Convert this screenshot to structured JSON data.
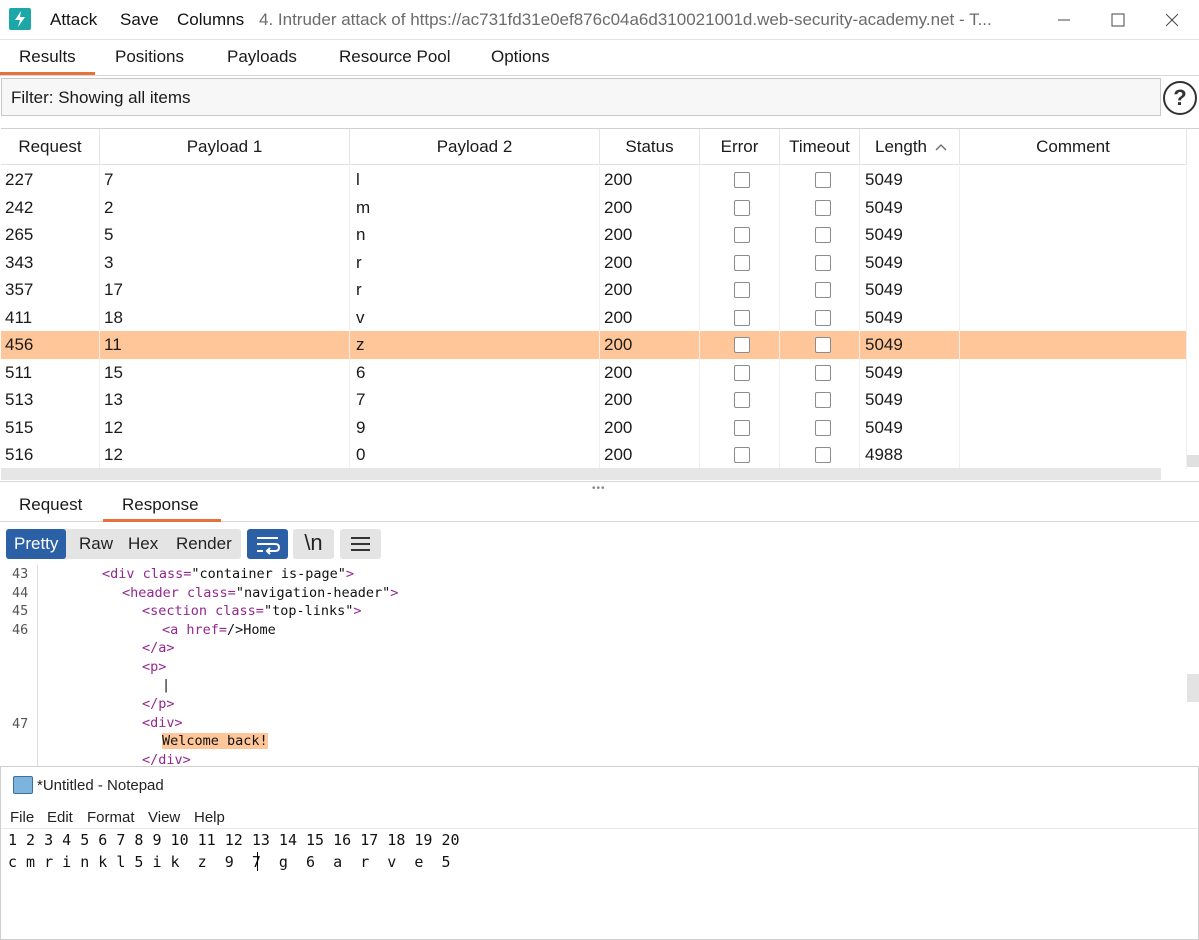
{
  "titlebar": {
    "menu": [
      "Attack",
      "Save",
      "Columns"
    ],
    "title": "4. Intruder attack of https://ac731fd31e0ef876c04a6d310021001d.web-security-academy.net - T..."
  },
  "tabs": [
    "Results",
    "Positions",
    "Payloads",
    "Resource Pool",
    "Options"
  ],
  "active_tab": "Results",
  "filter": {
    "text": "Filter: Showing all items",
    "help": "?"
  },
  "table": {
    "columns": [
      "Request",
      "Payload 1",
      "Payload 2",
      "Status",
      "Error",
      "Timeout",
      "Length",
      "Comment"
    ],
    "sort_column": "Length",
    "rows": [
      {
        "request": "227",
        "p1": "7",
        "p2": "l",
        "status": "200",
        "length": "5049"
      },
      {
        "request": "242",
        "p1": "2",
        "p2": "m",
        "status": "200",
        "length": "5049"
      },
      {
        "request": "265",
        "p1": "5",
        "p2": "n",
        "status": "200",
        "length": "5049"
      },
      {
        "request": "343",
        "p1": "3",
        "p2": "r",
        "status": "200",
        "length": "5049"
      },
      {
        "request": "357",
        "p1": "17",
        "p2": "r",
        "status": "200",
        "length": "5049"
      },
      {
        "request": "411",
        "p1": "18",
        "p2": "v",
        "status": "200",
        "length": "5049"
      },
      {
        "request": "456",
        "p1": "11",
        "p2": "z",
        "status": "200",
        "length": "5049",
        "selected": true
      },
      {
        "request": "511",
        "p1": "15",
        "p2": "6",
        "status": "200",
        "length": "5049"
      },
      {
        "request": "513",
        "p1": "13",
        "p2": "7",
        "status": "200",
        "length": "5049"
      },
      {
        "request": "515",
        "p1": "12",
        "p2": "9",
        "status": "200",
        "length": "5049"
      },
      {
        "request": "516",
        "p1": "12",
        "p2": "0",
        "status": "200",
        "length": "4988"
      }
    ]
  },
  "rr_tabs": [
    "Request",
    "Response"
  ],
  "rr_active": "Response",
  "view_modes": [
    "Pretty",
    "Raw",
    "Hex",
    "Render"
  ],
  "view_active": "Pretty",
  "view_icons": [
    "wrap-icon",
    "newline-icon",
    "menu-icon"
  ],
  "newline_label": "\\n",
  "code": {
    "line_numbers": [
      "43",
      "44",
      "45",
      "46",
      "47"
    ],
    "lines": [
      {
        "tag": "<div",
        "attr": " class=",
        "val": "\"container is-page\"",
        "end": ">"
      },
      {
        "tag": "<header",
        "attr": " class=",
        "val": "\"navigation-header\"",
        "end": ">"
      },
      {
        "tag": "<section",
        "attr": " class=",
        "val": "\"top-links\"",
        "end": ">"
      },
      {
        "tag": "<a",
        "attr": " href=",
        "val": "/>Home",
        "end": ""
      },
      {
        "tag": "</a>",
        "attr": "",
        "val": "",
        "end": ""
      },
      {
        "tag": "<p>",
        "attr": "",
        "val": "",
        "end": ""
      },
      {
        "tag": "",
        "attr": "",
        "val": "|",
        "end": ""
      },
      {
        "tag": "</p>",
        "attr": "",
        "val": "",
        "end": ""
      },
      {
        "tag": "<div>",
        "attr": "",
        "val": "",
        "end": ""
      },
      {
        "tag": "",
        "attr": "",
        "val": "Welcome back!",
        "end": ""
      },
      {
        "tag": "</div>",
        "attr": "",
        "val": "",
        "end": ""
      }
    ]
  },
  "notepad": {
    "title": "*Untitled - Notepad",
    "menu": [
      "File",
      "Edit",
      "Format",
      "View",
      "Help"
    ],
    "line1": "1 2 3 4 5 6 7 8 9 10 11 12 13 14 15 16 17 18 19 20",
    "line2": "c m r i n k l 5 i k  z  9  7  g  6  a  r  v  e  5"
  },
  "colors": {
    "accent": "#e8703a",
    "selected_row": "#ffc799",
    "pretty_button": "#2b5fa6",
    "app_icon": "#1ea7a7"
  }
}
